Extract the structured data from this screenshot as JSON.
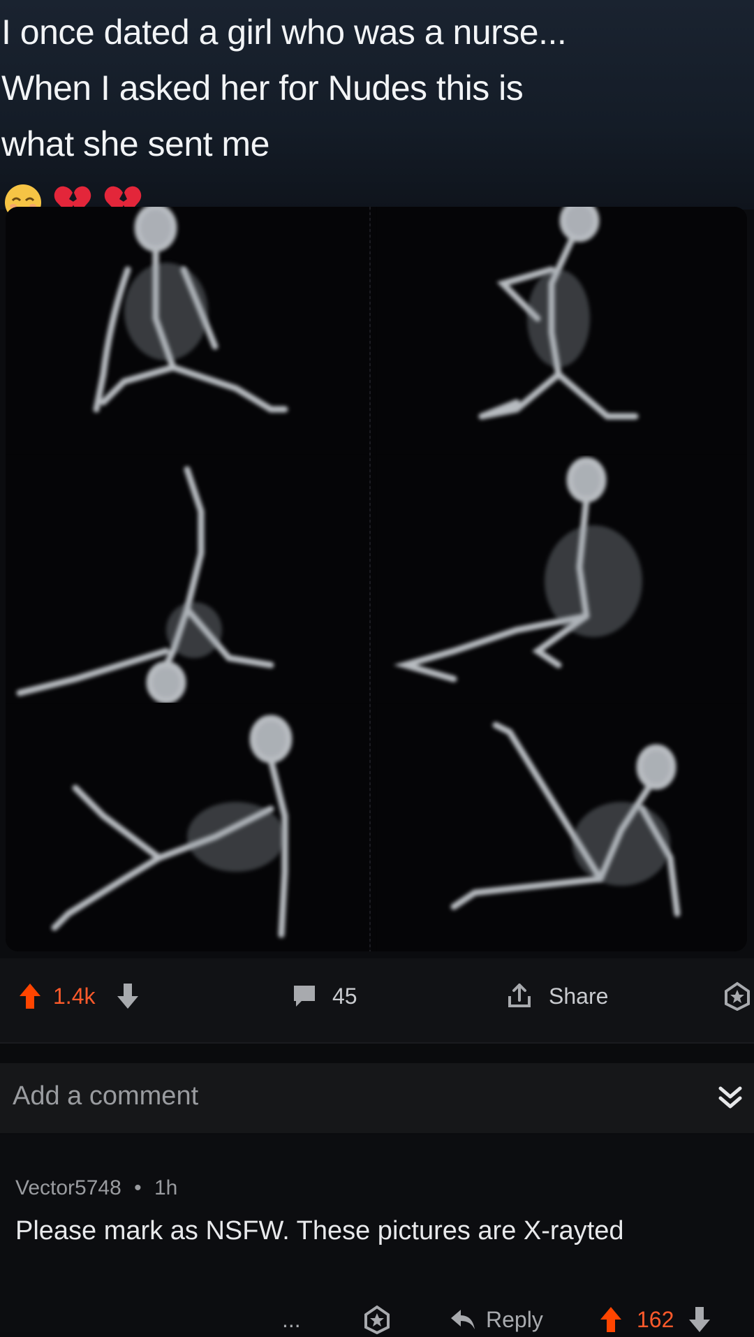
{
  "post": {
    "caption_lines": [
      "I once dated a girl who was a nurse...",
      "When I asked her for Nudes this is",
      "what she sent me"
    ],
    "caption_emojis": [
      "relieved-face-emoji",
      "broken-heart-emoji",
      "broken-heart-emoji"
    ],
    "image": {
      "panels": [
        "xray-pose-1",
        "xray-pose-2",
        "xray-pose-3",
        "xray-pose-4",
        "xray-pose-5",
        "xray-pose-6"
      ]
    },
    "votes": "1.4k",
    "comments_count": "45",
    "share_label": "Share"
  },
  "comment_box": {
    "placeholder": "Add a comment"
  },
  "comment": {
    "author": "Vector5748",
    "separator": "•",
    "time": "1h",
    "body": "Please mark as NSFW. These pictures are X-rayted",
    "more": "...",
    "reply_label": "Reply",
    "votes": "162"
  },
  "colors": {
    "upvote": "#ff4500",
    "background": "#0b0c0f",
    "text": "#e7e8ea",
    "muted": "#9a9ca0"
  }
}
